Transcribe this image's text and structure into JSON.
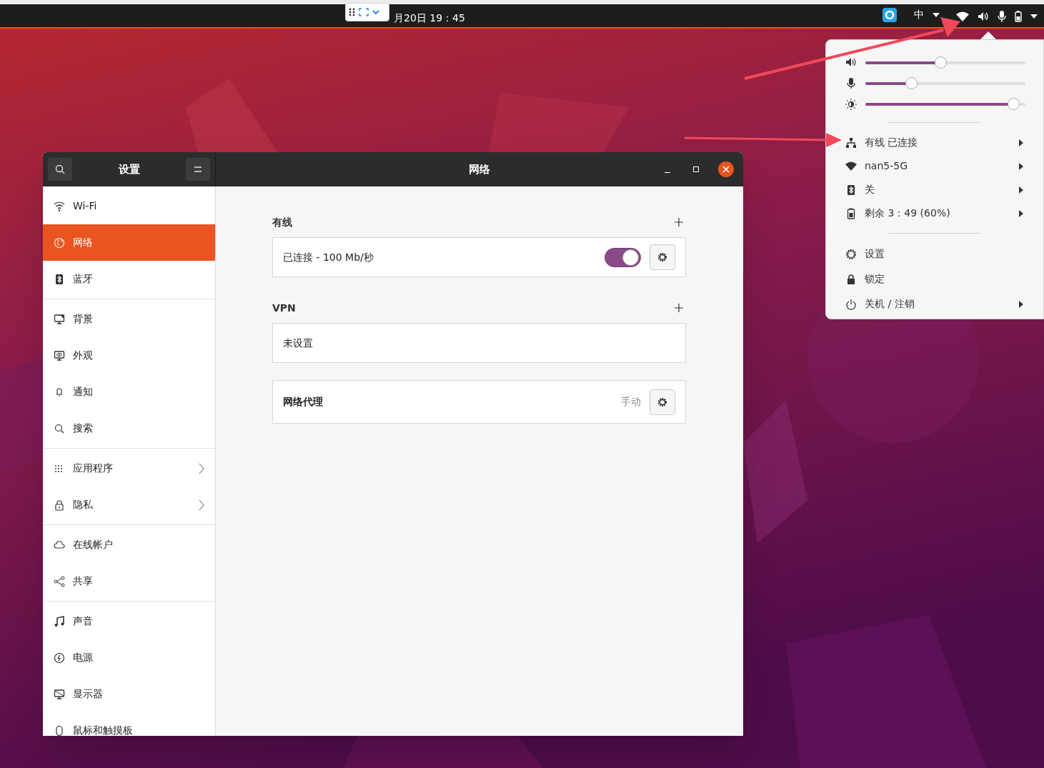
{
  "top_bar": {
    "clock": "月20日 19：45",
    "input_method": "中"
  },
  "system_menu": {
    "sliders": [
      {
        "kind": "volume",
        "level": 0.47
      },
      {
        "kind": "microphone",
        "level": 0.27
      },
      {
        "kind": "brightness",
        "level": 0.96
      }
    ],
    "status_items": [
      {
        "kind": "wired",
        "label": "有线 已连接",
        "submenu": true
      },
      {
        "kind": "wifi",
        "label": "nan5-5G",
        "submenu": true
      },
      {
        "kind": "bluetooth",
        "label": "关",
        "submenu": true
      },
      {
        "kind": "battery",
        "label": "剩余 3：49 (60%)",
        "submenu": true
      }
    ],
    "actions": [
      {
        "kind": "settings",
        "label": "设置",
        "submenu": false
      },
      {
        "kind": "lock",
        "label": "锁定",
        "submenu": false
      },
      {
        "kind": "power",
        "label": "关机 / 注销",
        "submenu": true
      }
    ]
  },
  "settings_window": {
    "sidebar_title": "设置",
    "panel_title": "网络",
    "sidebar_groups": [
      [
        {
          "label": "Wi-Fi",
          "selected": false
        },
        {
          "label": "网络",
          "selected": true
        },
        {
          "label": "蓝牙",
          "selected": false
        }
      ],
      [
        {
          "label": "背景",
          "selected": false
        },
        {
          "label": "外观",
          "selected": false
        },
        {
          "label": "通知",
          "selected": false
        },
        {
          "label": "搜索",
          "selected": false
        }
      ],
      [
        {
          "label": "应用程序",
          "selected": false,
          "chevron": true
        },
        {
          "label": "隐私",
          "selected": false,
          "chevron": true
        }
      ],
      [
        {
          "label": "在线帐户",
          "selected": false
        },
        {
          "label": "共享",
          "selected": false
        }
      ],
      [
        {
          "label": "声音",
          "selected": false
        },
        {
          "label": "电源",
          "selected": false
        },
        {
          "label": "显示器",
          "selected": false
        },
        {
          "label": "鼠标和触摸板",
          "selected": false
        }
      ]
    ],
    "sections": [
      {
        "heading": "有线",
        "rows": [
          {
            "kind": "connection",
            "label": "已连接 - 100 Mb/秒",
            "on": true
          }
        ]
      },
      {
        "heading": "VPN",
        "rows": [
          {
            "kind": "empty",
            "label": "未设置"
          }
        ]
      }
    ],
    "proxy": {
      "label": "网络代理",
      "value": "手动"
    }
  }
}
